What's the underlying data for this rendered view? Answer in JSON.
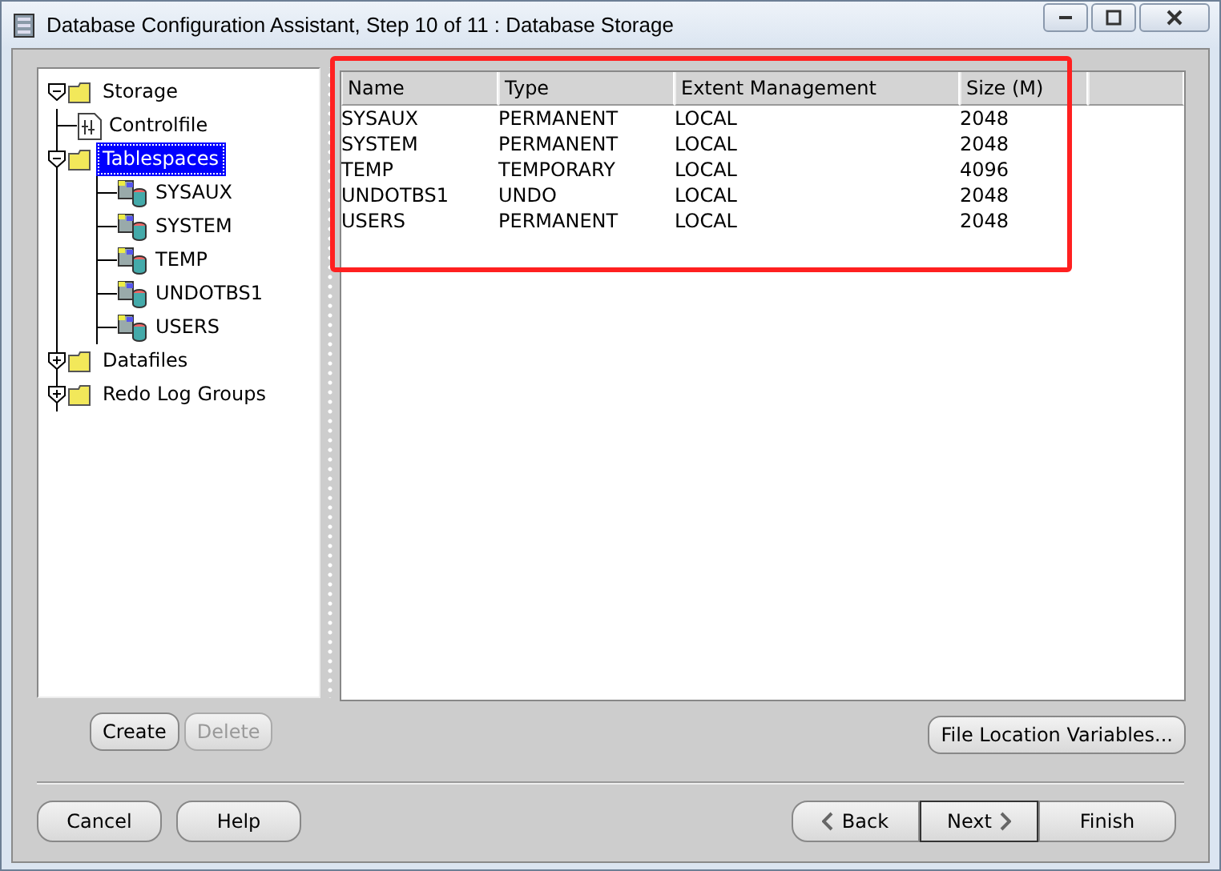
{
  "window": {
    "title": "Database Configuration Assistant, Step 10 of 11 : Database Storage"
  },
  "tree": [
    {
      "label": "Storage",
      "kind": "folder",
      "expanded": true,
      "selected": false,
      "children": [
        {
          "label": "Controlfile",
          "kind": "controlfile",
          "selected": false
        },
        {
          "label": "Tablespaces",
          "kind": "folder",
          "expanded": true,
          "selected": true,
          "children": [
            {
              "label": "SYSAUX",
              "kind": "tablespace",
              "selected": false
            },
            {
              "label": "SYSTEM",
              "kind": "tablespace",
              "selected": false
            },
            {
              "label": "TEMP",
              "kind": "tablespace",
              "selected": false
            },
            {
              "label": "UNDOTBS1",
              "kind": "tablespace",
              "selected": false
            },
            {
              "label": "USERS",
              "kind": "tablespace",
              "selected": false
            }
          ]
        },
        {
          "label": "Datafiles",
          "kind": "folder",
          "expanded": false,
          "selected": false
        },
        {
          "label": "Redo Log Groups",
          "kind": "folder",
          "expanded": false,
          "selected": false
        }
      ]
    }
  ],
  "table": {
    "columns": [
      "Name",
      "Type",
      "Extent Management",
      "Size (M)"
    ],
    "rows": [
      [
        "SYSAUX",
        "PERMANENT",
        "LOCAL",
        "2048"
      ],
      [
        "SYSTEM",
        "PERMANENT",
        "LOCAL",
        "2048"
      ],
      [
        "TEMP",
        "TEMPORARY",
        "LOCAL",
        "4096"
      ],
      [
        "UNDOTBS1",
        "UNDO",
        "LOCAL",
        "2048"
      ],
      [
        "USERS",
        "PERMANENT",
        "LOCAL",
        "2048"
      ]
    ]
  },
  "tree_buttons": [
    {
      "label": "Create",
      "disabled": false
    },
    {
      "label": "Delete",
      "disabled": true
    }
  ],
  "file_location_button": {
    "label": "File Location Variables..."
  },
  "left_buttons": [
    {
      "label": "Cancel",
      "disabled": false
    },
    {
      "label": "Help",
      "disabled": false
    }
  ],
  "nav_buttons": [
    {
      "label": "Back",
      "kind": "back",
      "disabled": false
    },
    {
      "label": "Next",
      "kind": "next",
      "disabled": false
    },
    {
      "label": "Finish",
      "kind": "finish",
      "disabled": false
    }
  ]
}
